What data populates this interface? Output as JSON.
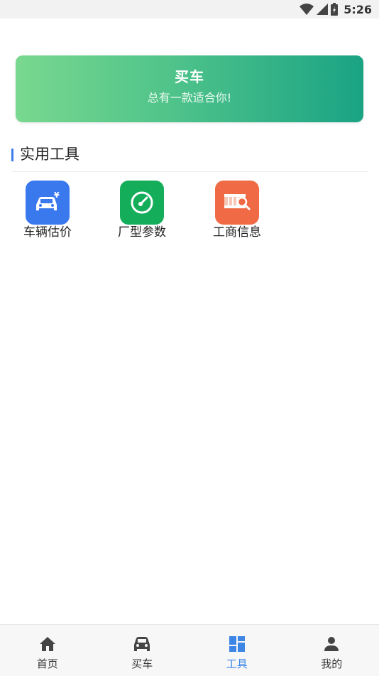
{
  "status_bar": {
    "time": "5:26"
  },
  "banner": {
    "title": "买车",
    "subtitle": "总有一款适合你!"
  },
  "section": {
    "title": "实用工具"
  },
  "tools": [
    {
      "label": "车辆估价",
      "icon": "car-price-icon",
      "color": "#3a78ee"
    },
    {
      "label": "厂型参数",
      "icon": "gauge-icon",
      "color": "#14ad5a"
    },
    {
      "label": "工商信息",
      "icon": "business-search-icon",
      "color": "#ef6a45"
    }
  ],
  "tabbar": {
    "active_color": "#3d86e6",
    "items": [
      {
        "label": "首页",
        "icon": "home-icon"
      },
      {
        "label": "买车",
        "icon": "car-icon"
      },
      {
        "label": "工具",
        "icon": "dashboard-icon"
      },
      {
        "label": "我的",
        "icon": "person-icon"
      }
    ]
  }
}
